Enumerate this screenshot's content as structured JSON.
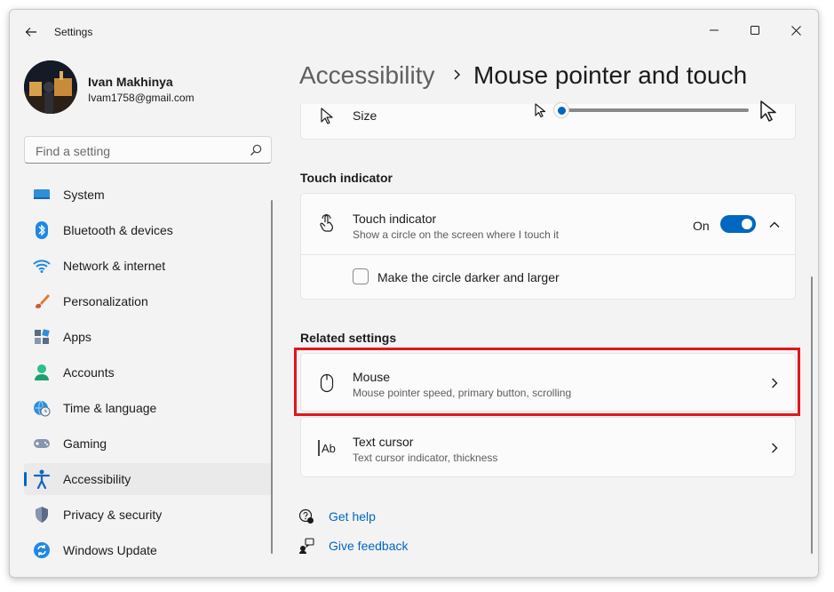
{
  "window": {
    "app_title": "Settings",
    "icons": {
      "back": "back-arrow-icon",
      "minimize": "minimize-icon",
      "maximize": "maximize-icon",
      "close": "close-icon"
    }
  },
  "profile": {
    "name": "Ivan Makhinya",
    "email": "Ivam1758@gmail.com"
  },
  "search": {
    "placeholder": "Find a setting",
    "icon": "search-icon"
  },
  "sidebar": {
    "items": [
      {
        "label": "System",
        "icon": "system-icon"
      },
      {
        "label": "Bluetooth & devices",
        "icon": "bluetooth-icon"
      },
      {
        "label": "Network & internet",
        "icon": "wifi-icon"
      },
      {
        "label": "Personalization",
        "icon": "brush-icon"
      },
      {
        "label": "Apps",
        "icon": "apps-icon"
      },
      {
        "label": "Accounts",
        "icon": "account-icon"
      },
      {
        "label": "Time & language",
        "icon": "globe-clock-icon"
      },
      {
        "label": "Gaming",
        "icon": "gamepad-icon"
      },
      {
        "label": "Accessibility",
        "icon": "accessibility-icon",
        "active": true
      },
      {
        "label": "Privacy & security",
        "icon": "shield-icon"
      },
      {
        "label": "Windows Update",
        "icon": "update-icon"
      }
    ]
  },
  "breadcrumb": {
    "parent": "Accessibility",
    "current": "Mouse pointer and touch"
  },
  "size_row": {
    "label": "Size",
    "slider_value": 0
  },
  "touch_section": {
    "title": "Touch indicator",
    "row_title": "Touch indicator",
    "row_desc": "Show a circle on the screen where I touch it",
    "toggle_state": "On",
    "checkbox_label": "Make the circle darker and larger"
  },
  "related": {
    "title": "Related settings",
    "items": [
      {
        "title": "Mouse",
        "desc": "Mouse pointer speed, primary button, scrolling",
        "icon": "mouse-icon"
      },
      {
        "title": "Text cursor",
        "desc": "Text cursor indicator, thickness",
        "icon": "text-cursor-icon"
      }
    ]
  },
  "links": {
    "help": "Get help",
    "feedback": "Give feedback"
  },
  "colors": {
    "accent": "#0067c0",
    "highlight": "#e3151c",
    "background": "#f3f3f3",
    "card": "#fbfbfb"
  }
}
